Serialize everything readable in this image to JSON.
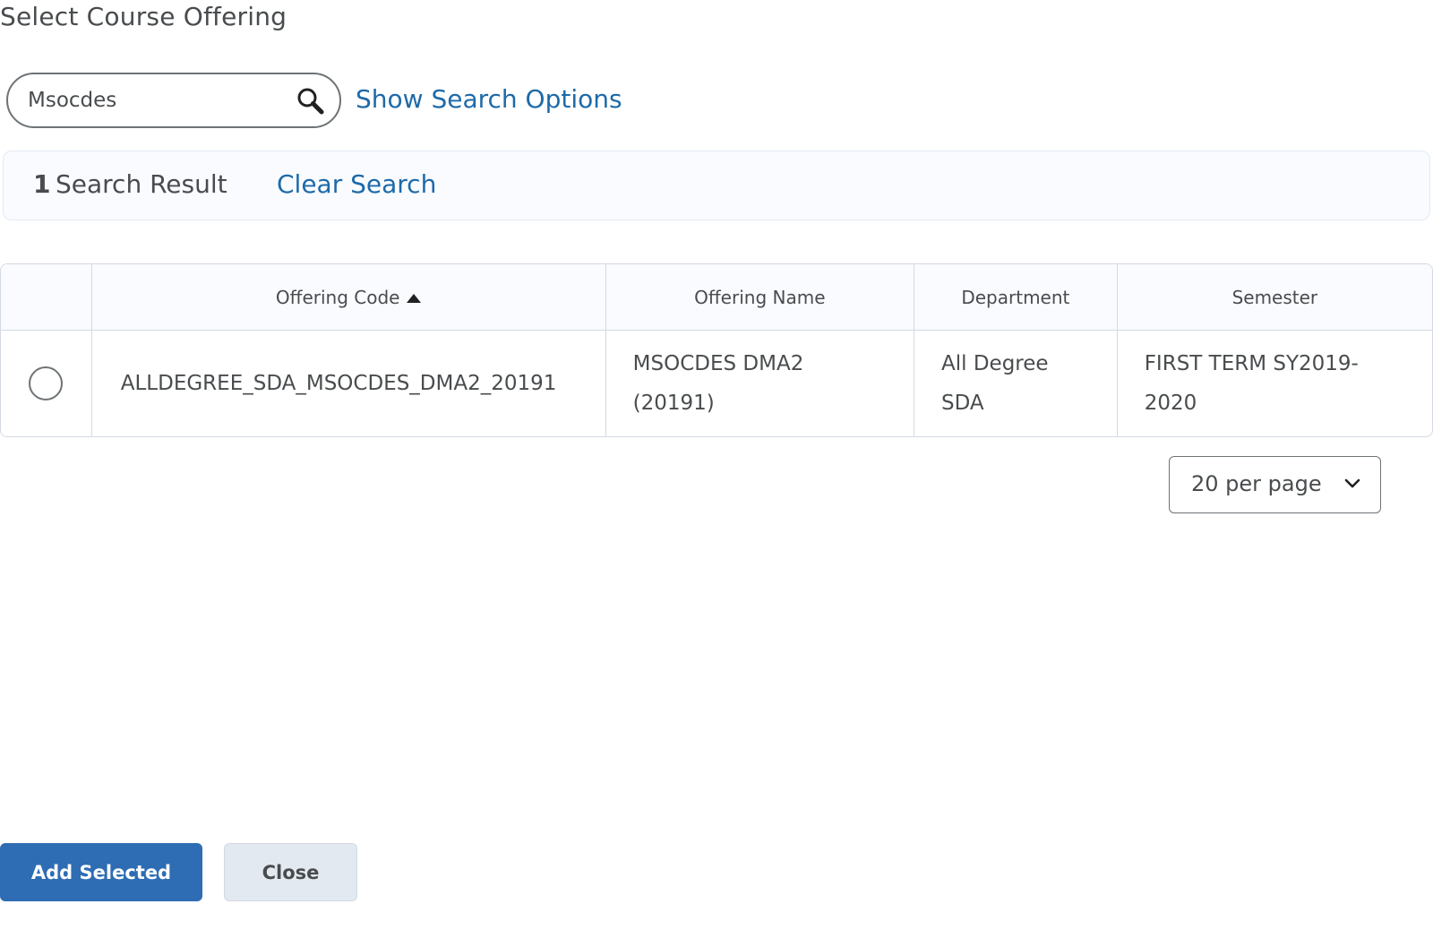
{
  "page": {
    "title": "Select Course Offering"
  },
  "search": {
    "value": "Msocdes",
    "placeholder": "",
    "show_options_label": "Show Search Options"
  },
  "results": {
    "count": "1",
    "label": "Search Result",
    "clear_label": "Clear Search"
  },
  "table": {
    "columns": [
      "",
      "Offering Code",
      "Offering Name",
      "Department",
      "Semester"
    ],
    "sorted_column": "Offering Code",
    "sort_direction": "ascending",
    "rows": [
      {
        "selected": false,
        "code": "ALLDEGREE_SDA_MSOCDES_DMA2_20191",
        "name": "MSOCDES DMA2 (20191)",
        "department": "All Degree SDA",
        "semester": "FIRST TERM SY2019-2020"
      }
    ]
  },
  "pagination": {
    "per_page_label": "20 per page"
  },
  "actions": {
    "add_selected_label": "Add Selected",
    "close_label": "Close"
  },
  "colors": {
    "primary": "#2e6db4",
    "link": "#1e6aa8",
    "text": "#494c4e",
    "secondary_button": "#e3e9f1"
  },
  "icons": {
    "search": "search-icon",
    "sort": "sort-ascending-icon",
    "dropdown": "chevron-down-icon"
  }
}
